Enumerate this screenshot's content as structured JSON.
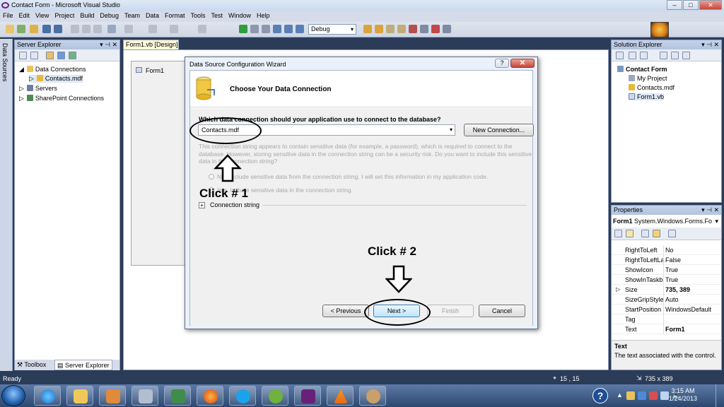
{
  "window": {
    "title": "Contact Form - Microsoft Visual Studio",
    "min": "–",
    "max": "□",
    "close": "✕"
  },
  "menu": [
    "File",
    "Edit",
    "View",
    "Project",
    "Build",
    "Debug",
    "Team",
    "Data",
    "Format",
    "Tools",
    "Test",
    "Window",
    "Help"
  ],
  "toolbar": {
    "config": "Debug"
  },
  "left_dock": {
    "label": "Data Sources"
  },
  "server_explorer": {
    "title": "Server Explorer",
    "controls": "▾ ⊣ ✕",
    "tree": [
      "Data Connections",
      "Contacts.mdf",
      "Servers",
      "SharePoint Connections"
    ],
    "tabs": [
      "Toolbox",
      "Server Explorer"
    ]
  },
  "document": {
    "tab": "Form1.vb [Design]",
    "form_title": "Form1"
  },
  "dialog": {
    "title": "Data Source Configuration Wizard",
    "help": "?",
    "close": "✕",
    "header": "Choose Your Data Connection",
    "question": "Which data connection should your application use to connect to the database?",
    "connection_value": "Contacts.mdf",
    "new_connection": "New Connection...",
    "warning": "This connection string appears to contain sensitive data (for example, a password), which is required to connect to the database. However, storing sensitive data in the connection string can be a security risk. Do you want to include this sensitive data in the connection string?",
    "radio1": "No, exclude sensitive data from the connection string. I will set this information in my application code.",
    "radio2": "Yes, include sensitive data in the connection string.",
    "connection_string_label": "Connection string",
    "buttons": {
      "previous": "< Previous",
      "next": "Next >",
      "finish": "Finish",
      "cancel": "Cancel"
    }
  },
  "annotations": {
    "click1": "Click # 1",
    "click2": "Click # 2"
  },
  "solution_explorer": {
    "title": "Solution Explorer",
    "controls": "▾ ⊣ ✕",
    "tree": [
      "Contact Form",
      "My Project",
      "Contacts.mdf",
      "Form1.vb"
    ]
  },
  "properties": {
    "title": "Properties",
    "controls": "▾ ⊣ ✕",
    "object": "Form1",
    "object_type": "System.Windows.Forms.Fo",
    "rows": [
      {
        "name": "RightToLeft",
        "value": "No"
      },
      {
        "name": "RightToLeftLa",
        "value": "False"
      },
      {
        "name": "ShowIcon",
        "value": "True"
      },
      {
        "name": "ShowInTaskb",
        "value": "True"
      },
      {
        "name": "Size",
        "value": "735, 389"
      },
      {
        "name": "SizeGripStyle",
        "value": "Auto"
      },
      {
        "name": "StartPosition",
        "value": "WindowsDefault"
      },
      {
        "name": "Tag",
        "value": ""
      },
      {
        "name": "Text",
        "value": "Form1"
      }
    ],
    "desc_title": "Text",
    "desc_text": "The text associated with the control."
  },
  "status": {
    "ready": "Ready",
    "position": "15 , 15",
    "size": "735 x 389"
  },
  "taskbar": {
    "time": "3:15 AM",
    "date": "1/24/2013",
    "help": "?"
  }
}
